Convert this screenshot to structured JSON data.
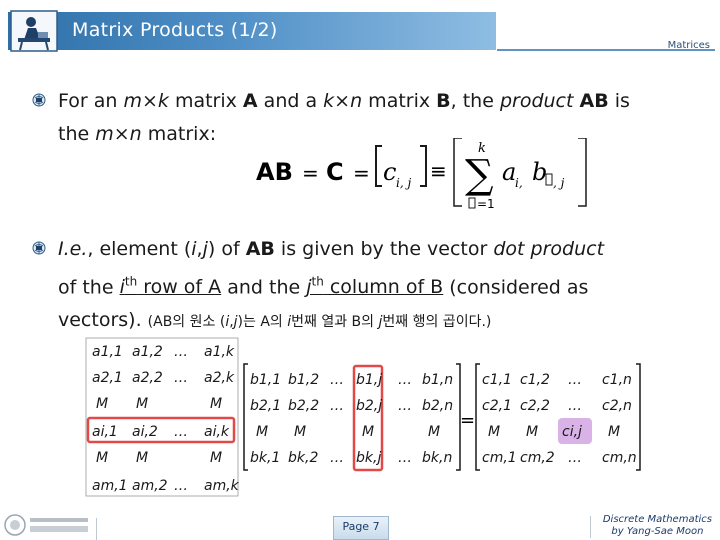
{
  "header": {
    "title": "Matrix Products (1/2)",
    "subject": "Matrices"
  },
  "bullets": [
    {
      "p1": "For an ",
      "p2": "m",
      "p3": "×",
      "p4": "k",
      "p5": " matrix ",
      "p6": "A",
      "p7": " and a ",
      "p8": "k",
      "p9": "×",
      "p10": "n",
      "p11": " matrix ",
      "p12": "B",
      "p13": ", the ",
      "p14": "product",
      "p15": " ",
      "p16": "AB",
      "p17": " is",
      "p18": "the ",
      "p19": "m",
      "p20": "×",
      "p21": "n",
      "p22": " matrix:"
    },
    {
      "p1": "I.e.",
      "p2": ", element (",
      "p3": "i",
      "p4": ",",
      "p5": "j",
      "p6": ") of ",
      "p7": "AB",
      "p8": " is given by the vector ",
      "p9": "dot product",
      "p10": "of the ",
      "p11": "i",
      "p12": "th",
      "p13": " row of A",
      "p14": " and the ",
      "p15": "j",
      "p16": "th",
      "p17": " column of B",
      "p18": " (considered as",
      "p19": "vectors). ",
      "p20": "(AB의 원소 (",
      "p21": "i",
      "p22": ",",
      "p23": "j",
      "p24": ")는 A의 ",
      "p25": "i",
      "p26": "번째 열과 B의 ",
      "p27": "j",
      "p28": "번째 행의 곱이다.)"
    }
  ],
  "formula": {
    "lhs": "AB",
    "eq1": "=",
    "c": "C",
    "eq2": "=",
    "c_elem": "c",
    "c_sub": "i, j",
    "equiv": "≡",
    "sum_top": "k",
    "sigma": "∑",
    "sum_bottom": "=1",
    "a": "a",
    "a_sub": "i,",
    "b": "b",
    "b_sub": ", j"
  },
  "matrix_a": {
    "rows": [
      [
        "a1,1",
        "a1,2",
        "…",
        "a1,k"
      ],
      [
        "a2,1",
        "a2,2",
        "…",
        "a2,k"
      ],
      [
        "M",
        "M",
        "",
        "M"
      ],
      [
        "ai,1",
        "ai,2",
        "…",
        "ai,k"
      ],
      [
        "M",
        "M",
        "",
        "M"
      ],
      [
        "am,1",
        "am,2",
        "…",
        "am,k"
      ]
    ]
  },
  "matrix_b": {
    "rows": [
      [
        "b1,1",
        "b1,2",
        "…",
        "b1,j",
        "…",
        "b1,n"
      ],
      [
        "b2,1",
        "b2,2",
        "…",
        "b2,j",
        "…",
        "b2,n"
      ],
      [
        "M",
        "M",
        "",
        "M",
        "",
        "M"
      ],
      [
        "bk,1",
        "bk,2",
        "…",
        "bk,j",
        "…",
        "bk,n"
      ]
    ]
  },
  "matrix_c": {
    "eq": "=",
    "rows": [
      [
        "c1,1",
        "c1,2",
        "…",
        "c1,n"
      ],
      [
        "c2,1",
        "c2,2",
        "…",
        "c2,n"
      ],
      [
        "M",
        "M",
        "ci,j",
        "M"
      ],
      [
        "cm,1",
        "cm,2",
        "…",
        "cm,n"
      ]
    ]
  },
  "footer": {
    "page": "Page 7",
    "credit_line1": "Discrete Mathematics",
    "credit_line2": "by Yang-Sae Moon"
  },
  "colors": {
    "title_band": "#3a7bb8",
    "highlight_row": "#e24a4a",
    "highlight_cell": "#d9b3e8",
    "accent": "#1c3b6b"
  },
  "icons": {
    "title_icon": "person-at-desk-icon",
    "bullet_icon": "globe-bullet-icon",
    "footer_logo": "university-logo"
  }
}
